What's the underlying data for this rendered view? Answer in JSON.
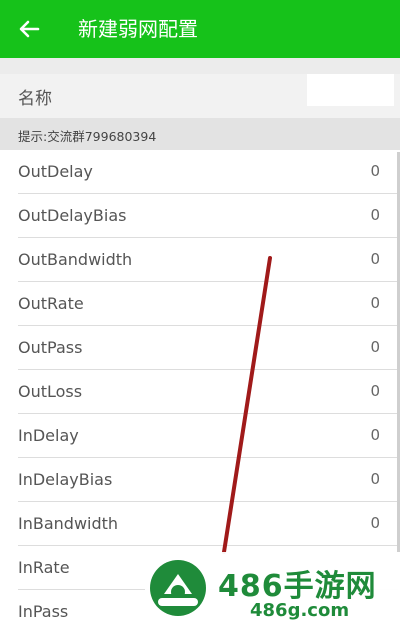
{
  "appbar": {
    "title": "新建弱网配置",
    "back_icon": "arrow-left-icon",
    "color": "#16c21a"
  },
  "name_field": {
    "label": "名称",
    "value": ""
  },
  "hint": "提示:交流群799680394",
  "settings": [
    {
      "label": "OutDelay",
      "value": "0"
    },
    {
      "label": "OutDelayBias",
      "value": "0"
    },
    {
      "label": "OutBandwidth",
      "value": "0"
    },
    {
      "label": "OutRate",
      "value": "0"
    },
    {
      "label": "OutPass",
      "value": "0"
    },
    {
      "label": "OutLoss",
      "value": "0"
    },
    {
      "label": "InDelay",
      "value": "0"
    },
    {
      "label": "InDelayBias",
      "value": "0"
    },
    {
      "label": "InBandwidth",
      "value": "0"
    },
    {
      "label": "InRate",
      "value": ""
    },
    {
      "label": "InPass",
      "value": ""
    }
  ],
  "watermark": {
    "main": "486手游网",
    "sub": "486g.com",
    "color": "#1f8b3a"
  }
}
